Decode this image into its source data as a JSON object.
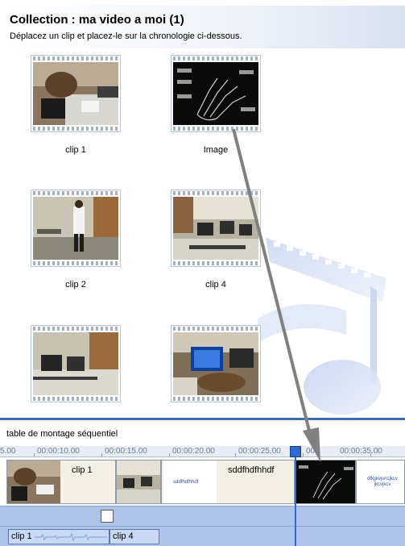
{
  "header": {
    "title": "Collection : ma  video a moi (1)",
    "subtitle": "Déplacez un clip et placez-le sur la chronologie ci-dessous."
  },
  "collection": {
    "clips": [
      {
        "caption": "clip 1",
        "scene": "person-at-desk"
      },
      {
        "caption": "Image",
        "scene": "hand-diagram"
      },
      {
        "caption": "clip 2",
        "scene": "person-standing"
      },
      {
        "caption": "clip 4",
        "scene": "computer-room"
      },
      {
        "caption": "",
        "scene": "desk-room"
      },
      {
        "caption": "",
        "scene": "monitor-closeup"
      }
    ]
  },
  "storyboard": {
    "label": "table de montage séquentiel",
    "ruler_ticks": [
      "5.00",
      "00:00:10.00",
      "00:00:15.00",
      "00:00:20.00",
      "00:00:25.00",
      "00",
      "00:00:35.00"
    ],
    "video_clips": [
      {
        "name": "clip 1"
      },
      {
        "name": ""
      },
      {
        "name": "sddfhdfhhdf",
        "mini_text": "sddfhdfhhdf"
      },
      {
        "name": "sddfhdfhhdf"
      },
      {
        "name": ""
      },
      {
        "name": "",
        "mini_text": "dfkjjkvjvncjkcv jkcvjkcv"
      }
    ],
    "audio_clips": [
      {
        "name": "clip 1"
      },
      {
        "name": "clip 4"
      }
    ]
  },
  "colors": {
    "accent": "#3a6ab8",
    "track": "#aec3ea",
    "playhead": "#2f6ad0",
    "arrow": "#808080"
  },
  "icons": [
    "music-note-watermark-icon",
    "drag-arrow-icon"
  ]
}
